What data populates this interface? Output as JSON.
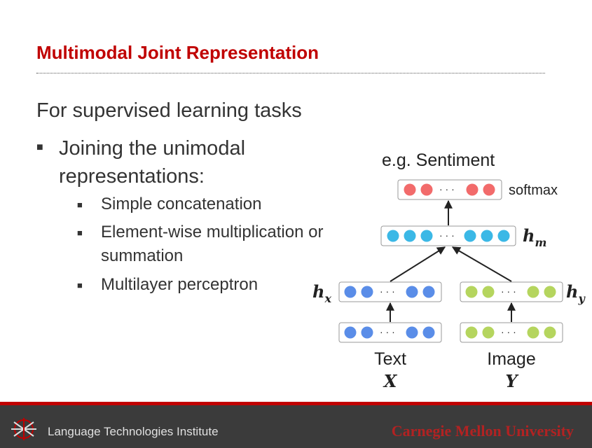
{
  "slide": {
    "title": "Multimodal Joint Representation",
    "intro": "For supervised learning tasks",
    "bullet_main": "Joining the unimodal representations:",
    "sub_bullets": [
      "Simple concatenation",
      "Element-wise multiplication or summation",
      "Multilayer perceptron"
    ]
  },
  "diagram": {
    "output_label": "e.g. Sentiment",
    "softmax_label": "softmax",
    "hm_label": "h",
    "hm_sub": "m",
    "hx_label": "h",
    "hx_sub": "x",
    "hy_label": "h",
    "hy_sub": "y",
    "ellipsis": "· · ·",
    "text_label": "Text",
    "text_var": "X",
    "image_label": "Image",
    "image_var": "Y",
    "colors": {
      "red": "#f26b6b",
      "cyan": "#3bb8e6",
      "blue": "#5a8de8",
      "green": "#b5d55e"
    }
  },
  "footer": {
    "institute": "Language Technologies Institute",
    "university": "Carnegie Mellon University"
  }
}
